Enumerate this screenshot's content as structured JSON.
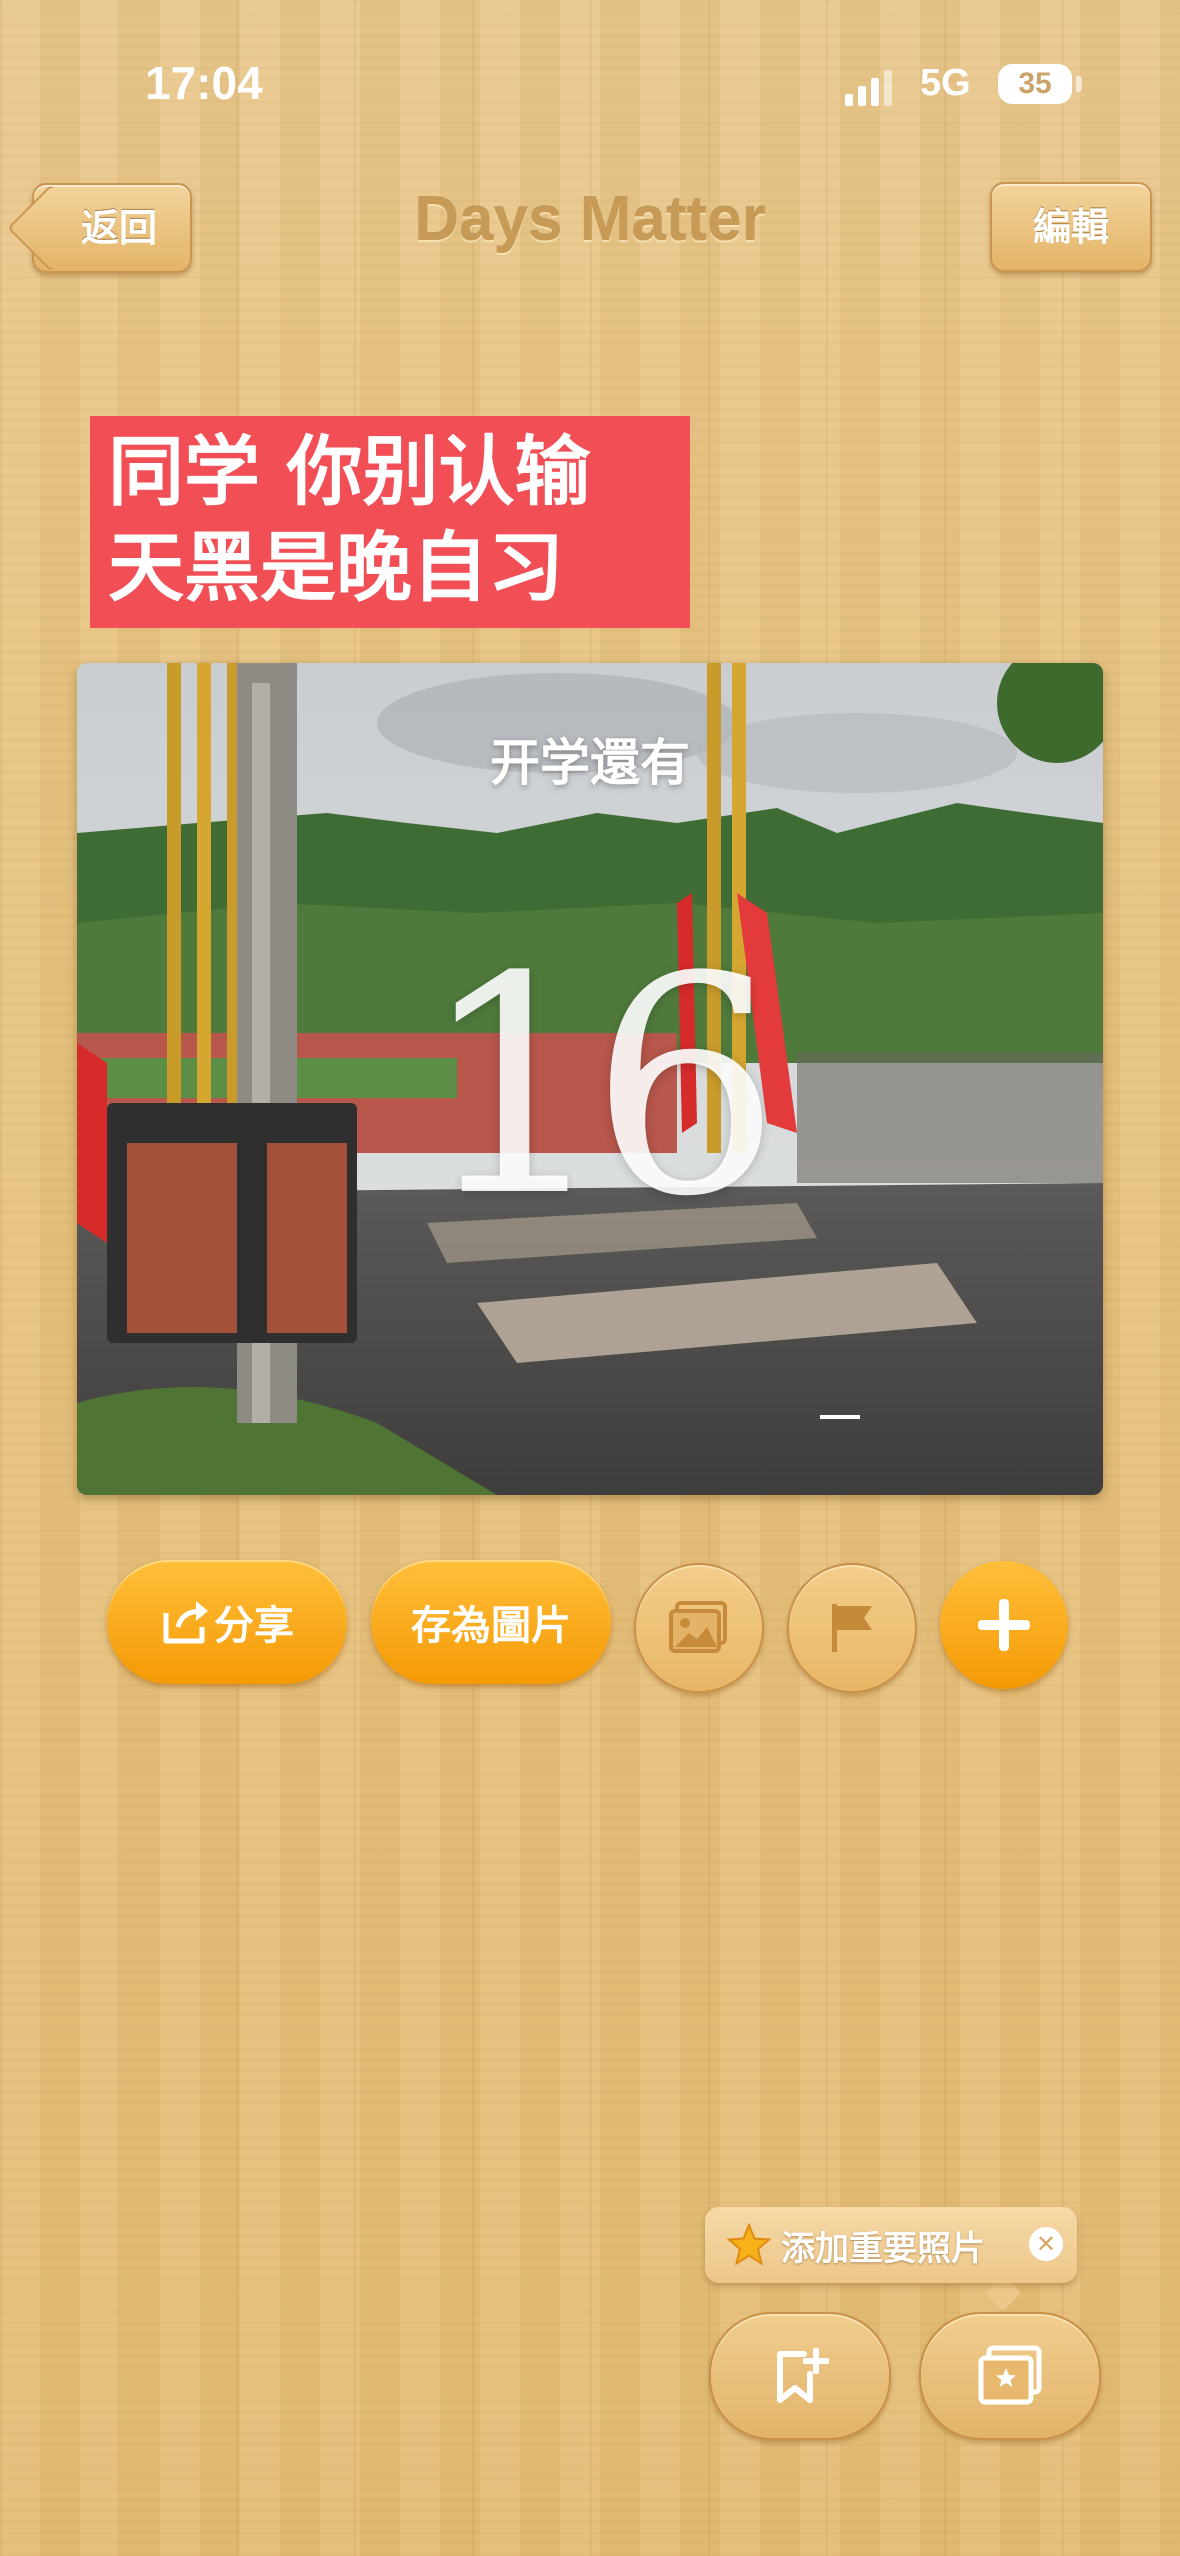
{
  "status_bar": {
    "time": "17:04",
    "network": "5G",
    "battery": "35"
  },
  "nav": {
    "back_label": "返回",
    "title": "Days Matter",
    "edit_label": "編輯"
  },
  "banner": {
    "line1": "同学 你别认输",
    "line2": "天黑是晚自习"
  },
  "card": {
    "label": "开学還有",
    "days": "16"
  },
  "actions": {
    "share_label": "分享",
    "save_image_label": "存為圖片"
  },
  "tooltip": {
    "text": "添加重要照片"
  },
  "icons": [
    "share-icon",
    "image-icon",
    "flag-icon",
    "plus-icon",
    "star-icon",
    "close-icon",
    "bookmark-add-icon",
    "photo-album-icon"
  ],
  "colors": {
    "accent_orange": "#f7a30c",
    "banner_red": "#f24e55",
    "wood": "#e7c37f",
    "title_brown": "#c79b55"
  }
}
